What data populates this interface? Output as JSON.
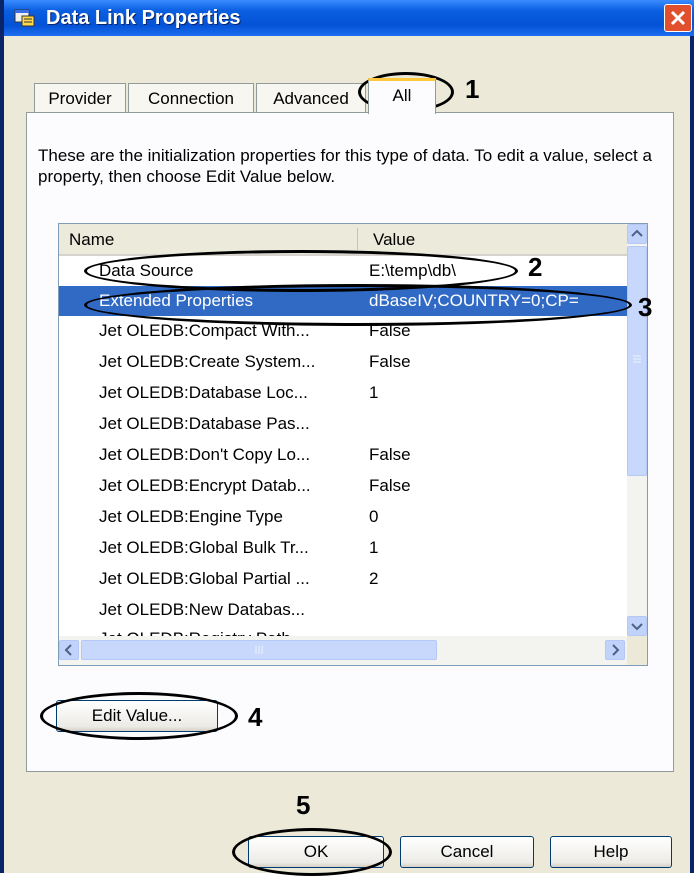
{
  "window": {
    "title": "Data Link Properties"
  },
  "tabs": [
    {
      "label": "Provider"
    },
    {
      "label": "Connection"
    },
    {
      "label": "Advanced"
    },
    {
      "label": "All"
    }
  ],
  "description": "These are the initialization properties for this type of data. To edit a value, select a property, then choose Edit Value below.",
  "table": {
    "headers": {
      "name": "Name",
      "value": "Value"
    },
    "rows": [
      {
        "name": "Data Source",
        "value": "E:\\temp\\db\\"
      },
      {
        "name": "Extended Properties",
        "value": "dBaseIV;COUNTRY=0;CP="
      },
      {
        "name": "Jet OLEDB:Compact With...",
        "value": "False"
      },
      {
        "name": "Jet OLEDB:Create System...",
        "value": "False"
      },
      {
        "name": "Jet OLEDB:Database Loc...",
        "value": "1"
      },
      {
        "name": "Jet OLEDB:Database Pas...",
        "value": ""
      },
      {
        "name": "Jet OLEDB:Don't Copy Lo...",
        "value": "False"
      },
      {
        "name": "Jet OLEDB:Encrypt Datab...",
        "value": "False"
      },
      {
        "name": "Jet OLEDB:Engine Type",
        "value": "0"
      },
      {
        "name": "Jet OLEDB:Global Bulk Tr...",
        "value": "1"
      },
      {
        "name": "Jet OLEDB:Global Partial ...",
        "value": "2"
      },
      {
        "name": "Jet OLEDB:New Databas...",
        "value": ""
      },
      {
        "name": "Jet OLEDB:Registry Path",
        "value": ""
      }
    ],
    "selected_row": 1
  },
  "buttons": {
    "edit_value": "Edit Value...",
    "ok": "OK",
    "cancel": "Cancel",
    "help": "Help"
  },
  "annotations": [
    "1",
    "2",
    "3",
    "4",
    "5"
  ],
  "colors": {
    "title_bar": "#0a5fe0",
    "selection": "#316ac5",
    "dialog_bg": "#ece9d8",
    "close_button": "#e0502c"
  }
}
